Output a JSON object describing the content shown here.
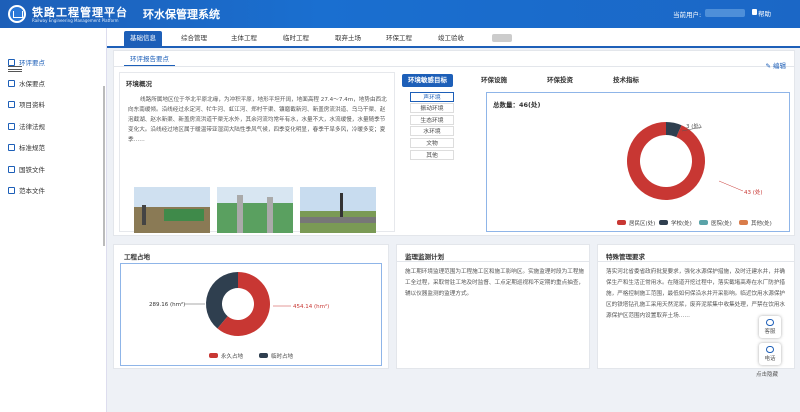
{
  "header": {
    "brand": "铁路工程管理平台",
    "brand_en": "Railway Engineering Management Platform",
    "system": "环水保管理系统",
    "user_label": "当前用户:",
    "help": "帮助"
  },
  "tabs": [
    "基础信息",
    "综合管理",
    "主体工程",
    "临时工程",
    "取弃土场",
    "环保工程",
    "竣工验收"
  ],
  "active_tab": "基础信息",
  "sidebar": {
    "items": [
      "环评要点",
      "水保要点",
      "项目资料",
      "法律法规",
      "标准规范",
      "国铁文件",
      "范本文件"
    ]
  },
  "subtab": "环评报告要点",
  "edit": "编辑",
  "overview": {
    "title": "环境概况",
    "text": "线路所属地区位于华北平原北缘，为冲积平原，地形平坦开阔，地面高程 27.4～7.4m，地势由西北向东南缓倾。沿线经过永定河、牤牛河、虹江河、郑村干渠、镰磨截新河、新盖房流洪道、乌马干渠、赵泡截湖、赵水新渠、新盖房流洪道干渠无水外，其余河流均常年有水，水量不大，水流缓慢，水量随季节变化大。沿线经过地区属于暖温带亚湿润大陆性季风气候，四季变化明显，春季干旱多风，冷暖多变；夏季……"
  },
  "env_tabs": [
    "环境敏感目标",
    "环保设施",
    "环保投资",
    "技术指标"
  ],
  "categories": [
    "声环境",
    "振动环境",
    "生态环境",
    "水环境",
    "文物",
    "其他"
  ],
  "sensitive_chart": {
    "total_label": "总数量：46(处)",
    "labels": [
      "3 (处)",
      "43 (处)"
    ],
    "legend": [
      "居民区(处)",
      "学校(处)",
      "医院(处)",
      "其他(处)"
    ]
  },
  "site": {
    "title": "工程占地",
    "left_label": "289.16 (hm²)",
    "right_label": "454.14 (hm²)",
    "legend": [
      "永久占地",
      "临时占地"
    ]
  },
  "monitor": {
    "title": "监理监测计划",
    "text": "施工期环境监理范围为工程施工区和施工影响区。实施监理时段为工程施工全过程，采取常驻工地及时监督、工点定期巡视和不定期的重点抽查，辅以仪器监测的监理方式。"
  },
  "special": {
    "title": "特殊管理要求",
    "text": "落实河北省委省政府批复要求，强化水源保护措施，及时迁建水井，并确保生产和生活正常用水。在隧道开挖过程中，落实截堵高寿在水厂防护措施，严格控制施工范围，最低如何保沿水井开采影响。临近饮用水源保护区的铁塔钻孔施工采用天然泥浆，废弃泥浆集中收集处理，严禁在饮用水源保护区范围内设置取弃土场……"
  },
  "float": {
    "kefu": "客服",
    "tel": "电话",
    "hide": "点击隐藏"
  },
  "chart_data": [
    {
      "type": "pie",
      "title": "总数量：46(处)",
      "categories": [
        "居民区(处)",
        "学校(处)",
        "医院(处)",
        "其他(处)"
      ],
      "values": [
        43,
        3,
        0,
        0
      ],
      "colors": [
        "#c83733",
        "#2f3f4f",
        "#5aa3a8",
        "#d97c4a"
      ]
    },
    {
      "type": "pie",
      "categories": [
        "永久占地",
        "临时占地"
      ],
      "values": [
        454.14,
        289.16
      ],
      "colors": [
        "#c83733",
        "#2f3f4f"
      ]
    }
  ]
}
